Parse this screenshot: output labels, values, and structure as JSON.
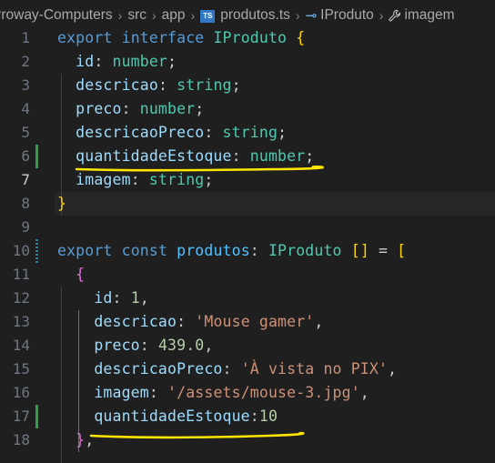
{
  "breadcrumb": {
    "project": "Proway-Computers",
    "folder1": "src",
    "folder2": "app",
    "file_badge": "TS",
    "file": "produtos.ts",
    "symbol1": "IProduto",
    "symbol2": "imagem"
  },
  "lines": [
    {
      "n": "1",
      "tokens": [
        [
          "kw",
          "export"
        ],
        [
          "punc",
          " "
        ],
        [
          "kw",
          "interface"
        ],
        [
          "punc",
          " "
        ],
        [
          "cls",
          "IProduto"
        ],
        [
          "punc",
          " "
        ],
        [
          "b1",
          "{"
        ]
      ]
    },
    {
      "n": "2",
      "tokens": [
        [
          "punc",
          "  "
        ],
        [
          "prop",
          "id"
        ],
        [
          "punc",
          ": "
        ],
        [
          "type",
          "number"
        ],
        [
          "punc",
          ";"
        ]
      ]
    },
    {
      "n": "3",
      "tokens": [
        [
          "punc",
          "  "
        ],
        [
          "prop",
          "descricao"
        ],
        [
          "punc",
          ": "
        ],
        [
          "type",
          "string"
        ],
        [
          "punc",
          ";"
        ]
      ]
    },
    {
      "n": "4",
      "tokens": [
        [
          "punc",
          "  "
        ],
        [
          "prop",
          "preco"
        ],
        [
          "punc",
          ": "
        ],
        [
          "type",
          "number"
        ],
        [
          "punc",
          ";"
        ]
      ]
    },
    {
      "n": "5",
      "tokens": [
        [
          "punc",
          "  "
        ],
        [
          "prop",
          "descricaoPreco"
        ],
        [
          "punc",
          ": "
        ],
        [
          "type",
          "string"
        ],
        [
          "punc",
          ";"
        ]
      ]
    },
    {
      "n": "6",
      "tokens": [
        [
          "punc",
          "  "
        ],
        [
          "prop",
          "quantidadeEstoque"
        ],
        [
          "punc",
          ": "
        ],
        [
          "type",
          "number"
        ],
        [
          "punc",
          ";"
        ]
      ]
    },
    {
      "n": "7",
      "tokens": [
        [
          "punc",
          "  "
        ],
        [
          "prop",
          "imagem"
        ],
        [
          "punc",
          ": "
        ],
        [
          "type",
          "string"
        ],
        [
          "punc",
          ";"
        ]
      ]
    },
    {
      "n": "8",
      "tokens": [
        [
          "b1",
          "}"
        ]
      ]
    },
    {
      "n": "9",
      "tokens": []
    },
    {
      "n": "10",
      "tokens": [
        [
          "kw",
          "export"
        ],
        [
          "punc",
          " "
        ],
        [
          "kw",
          "const"
        ],
        [
          "punc",
          " "
        ],
        [
          "var",
          "produtos"
        ],
        [
          "punc",
          ": "
        ],
        [
          "cls",
          "IProduto"
        ],
        [
          "punc",
          " "
        ],
        [
          "b1",
          "[]"
        ],
        [
          "punc",
          " = "
        ],
        [
          "b1",
          "["
        ]
      ]
    },
    {
      "n": "11",
      "tokens": [
        [
          "punc",
          "  "
        ],
        [
          "b2",
          "{"
        ]
      ]
    },
    {
      "n": "12",
      "tokens": [
        [
          "punc",
          "    "
        ],
        [
          "prop",
          "id"
        ],
        [
          "punc",
          ": "
        ],
        [
          "num",
          "1"
        ],
        [
          "punc",
          ","
        ]
      ]
    },
    {
      "n": "13",
      "tokens": [
        [
          "punc",
          "    "
        ],
        [
          "prop",
          "descricao"
        ],
        [
          "punc",
          ": "
        ],
        [
          "str",
          "'Mouse gamer'"
        ],
        [
          "punc",
          ","
        ]
      ]
    },
    {
      "n": "14",
      "tokens": [
        [
          "punc",
          "    "
        ],
        [
          "prop",
          "preco"
        ],
        [
          "punc",
          ": "
        ],
        [
          "num",
          "439.0"
        ],
        [
          "punc",
          ","
        ]
      ]
    },
    {
      "n": "15",
      "tokens": [
        [
          "punc",
          "    "
        ],
        [
          "prop",
          "descricaoPreco"
        ],
        [
          "punc",
          ": "
        ],
        [
          "str",
          "'À vista no PIX'"
        ],
        [
          "punc",
          ","
        ]
      ]
    },
    {
      "n": "16",
      "tokens": [
        [
          "punc",
          "    "
        ],
        [
          "prop",
          "imagem"
        ],
        [
          "punc",
          ": "
        ],
        [
          "str",
          "'/assets/mouse-3.jpg'"
        ],
        [
          "punc",
          ","
        ]
      ]
    },
    {
      "n": "17",
      "tokens": [
        [
          "punc",
          "    "
        ],
        [
          "prop",
          "quantidadeEstoque"
        ],
        [
          "punc",
          ":"
        ],
        [
          "num",
          "10"
        ]
      ]
    },
    {
      "n": "18",
      "tokens": [
        [
          "punc",
          "  "
        ],
        [
          "b2",
          "}"
        ],
        [
          "punc",
          ","
        ]
      ]
    }
  ],
  "colors": {
    "background": "#1f1f1f",
    "annotation_underline": "#ffe600",
    "gutter_added": "#2ea043",
    "gutter_modified": "#1b81a8"
  },
  "icons": {
    "file_type": "typescript-file-icon",
    "symbol_interface": "interface-icon",
    "symbol_property": "wrench-icon"
  }
}
